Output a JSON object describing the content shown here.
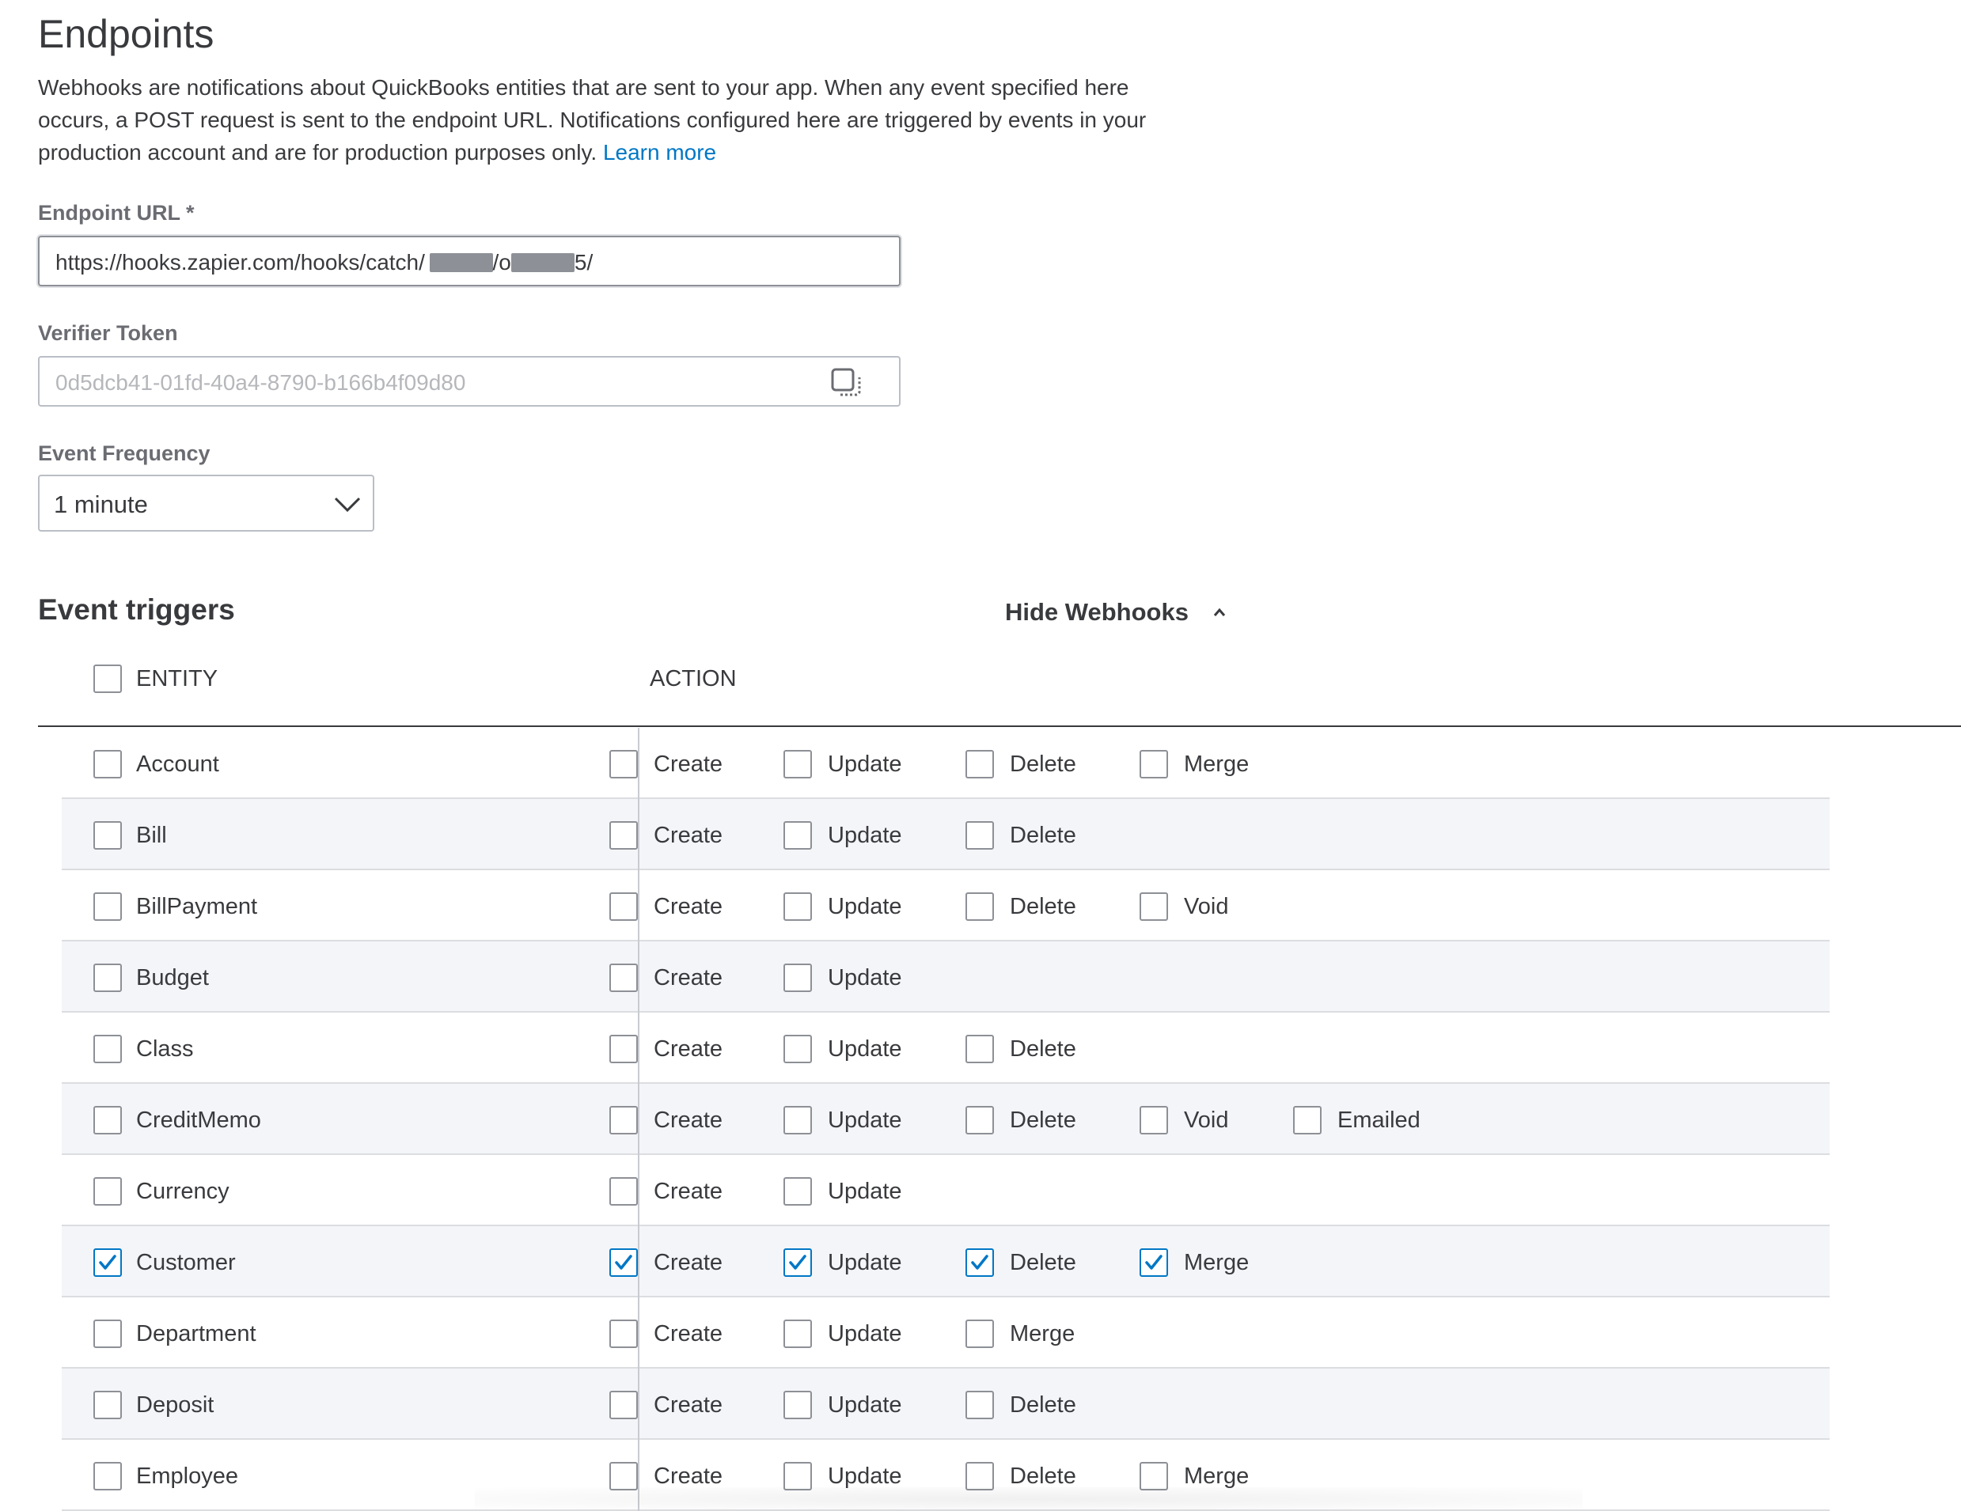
{
  "page": {
    "title": "Endpoints",
    "description": "Webhooks are notifications about QuickBooks entities that are sent to your app. When any event specified here occurs, a POST request is sent to the endpoint URL. Notifications configured here are triggered by events in your production account and are for production purposes only.",
    "learn_more": "Learn more"
  },
  "endpoint_url": {
    "label": "Endpoint URL *",
    "value_prefix": "https://hooks.zapier.com/hooks/catch/",
    "value_parts": [
      " ",
      "/o",
      "5/"
    ]
  },
  "verifier_token": {
    "label": "Verifier Token",
    "value": "0d5dcb41-01fd-40a4-8790-b166b4f09d80",
    "icon": "copy-icon"
  },
  "event_frequency": {
    "label": "Event Frequency",
    "selected": "1 minute",
    "icon": "chevron-down-icon"
  },
  "event_triggers": {
    "title": "Event triggers",
    "toggle_label": "Hide Webhooks",
    "toggle_icon": "chevron-up-icon",
    "header": {
      "entity": "ENTITY",
      "action": "ACTION",
      "select_all": false
    },
    "rows": [
      {
        "entity": "Account",
        "checked": false,
        "actions": [
          {
            "label": "Create",
            "checked": false
          },
          {
            "label": "Update",
            "checked": false
          },
          {
            "label": "Delete",
            "checked": false
          },
          {
            "label": "Merge",
            "checked": false
          }
        ]
      },
      {
        "entity": "Bill",
        "checked": false,
        "actions": [
          {
            "label": "Create",
            "checked": false
          },
          {
            "label": "Update",
            "checked": false
          },
          {
            "label": "Delete",
            "checked": false
          }
        ]
      },
      {
        "entity": "BillPayment",
        "checked": false,
        "actions": [
          {
            "label": "Create",
            "checked": false
          },
          {
            "label": "Update",
            "checked": false
          },
          {
            "label": "Delete",
            "checked": false
          },
          {
            "label": "Void",
            "checked": false
          }
        ]
      },
      {
        "entity": "Budget",
        "checked": false,
        "actions": [
          {
            "label": "Create",
            "checked": false
          },
          {
            "label": "Update",
            "checked": false
          }
        ]
      },
      {
        "entity": "Class",
        "checked": false,
        "actions": [
          {
            "label": "Create",
            "checked": false
          },
          {
            "label": "Update",
            "checked": false
          },
          {
            "label": "Delete",
            "checked": false
          }
        ]
      },
      {
        "entity": "CreditMemo",
        "checked": false,
        "actions": [
          {
            "label": "Create",
            "checked": false
          },
          {
            "label": "Update",
            "checked": false
          },
          {
            "label": "Delete",
            "checked": false
          },
          {
            "label": "Void",
            "checked": false
          },
          {
            "label": "Emailed",
            "checked": false
          }
        ]
      },
      {
        "entity": "Currency",
        "checked": false,
        "actions": [
          {
            "label": "Create",
            "checked": false
          },
          {
            "label": "Update",
            "checked": false
          }
        ]
      },
      {
        "entity": "Customer",
        "checked": true,
        "actions": [
          {
            "label": "Create",
            "checked": true
          },
          {
            "label": "Update",
            "checked": true
          },
          {
            "label": "Delete",
            "checked": true
          },
          {
            "label": "Merge",
            "checked": true
          }
        ]
      },
      {
        "entity": "Department",
        "checked": false,
        "actions": [
          {
            "label": "Create",
            "checked": false
          },
          {
            "label": "Update",
            "checked": false
          },
          {
            "label": "Merge",
            "checked": false
          }
        ]
      },
      {
        "entity": "Deposit",
        "checked": false,
        "actions": [
          {
            "label": "Create",
            "checked": false
          },
          {
            "label": "Update",
            "checked": false
          },
          {
            "label": "Delete",
            "checked": false
          }
        ]
      },
      {
        "entity": "Employee",
        "checked": false,
        "actions": [
          {
            "label": "Create",
            "checked": false
          },
          {
            "label": "Update",
            "checked": false
          },
          {
            "label": "Delete",
            "checked": false
          },
          {
            "label": "Merge",
            "checked": false
          }
        ]
      }
    ]
  },
  "colors": {
    "accent": "#0077c5",
    "text": "#393a3d",
    "muted_label": "#6b6c72",
    "row_alt": "#f4f5f8",
    "border": "#8d9096"
  }
}
